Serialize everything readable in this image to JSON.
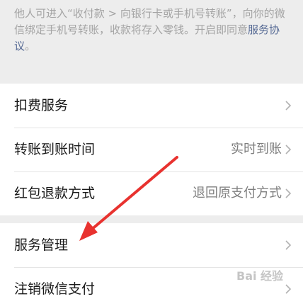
{
  "notice": {
    "text": "他人可进入“收付款 > 向银行卡或手机号转账”，向你的微信绑定手机号转账，收款将存入零钱。开启即同意",
    "link": "服务协议",
    "end": "。"
  },
  "group1": [
    {
      "label": "扣费服务",
      "value": ""
    },
    {
      "label": "转账到账时间",
      "value": "实时到账"
    },
    {
      "label": "红包退款方式",
      "value": "退回原支付方式"
    }
  ],
  "group2": [
    {
      "label": "服务管理",
      "value": ""
    },
    {
      "label": "注销微信支付",
      "value": ""
    }
  ],
  "watermark": "Bai 经验",
  "colors": {
    "accent_link": "#576b95",
    "annotation_arrow": "#e8322f"
  }
}
